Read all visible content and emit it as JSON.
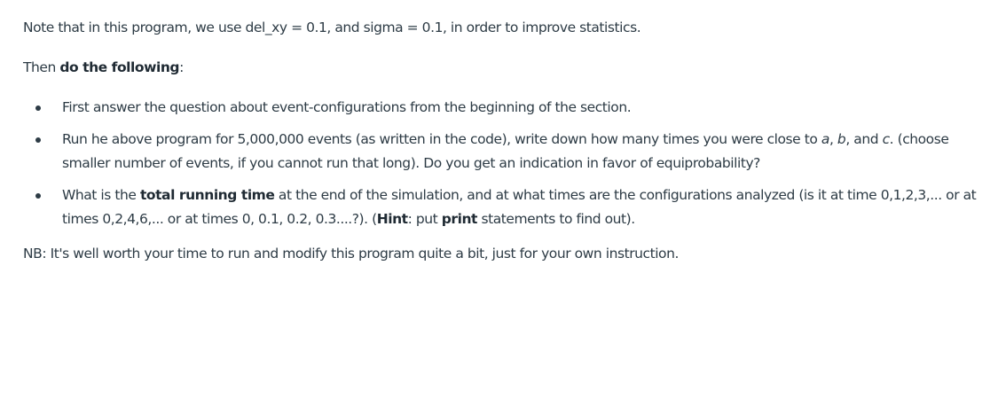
{
  "paragraph_note": "Note that in this program, we use del_xy = 0.1, and sigma = 0.1, in order to improve statistics.",
  "paragraph_then": {
    "prefix": "Then ",
    "bold": "do the following",
    "suffix": ":"
  },
  "bullets": [
    {
      "text": "First answer the  question about event-configurations from the beginning of the section."
    },
    {
      "part1": "Run he above program for 5,000,000 events (as written in the code), write down how many times you were close to ",
      "a": "a",
      "sep1": ", ",
      "b": "b",
      "sep2": ", and ",
      "c": "c",
      "part2": ". (choose smaller number of events, if you cannot run that long). Do you get an indication in favor of equiprobability?"
    },
    {
      "part1": "What is the ",
      "bold1": "total running time",
      "part2": " at the end of the simulation, and at what times are the configurations analyzed  (is it at time 0,1,2,3,... or at times 0,2,4,6,... or at times 0, 0.1, 0.2, 0.3....?). (",
      "bold2": "Hint",
      "part3": ": put ",
      "bold3": "print",
      "part4": " statements to find out)."
    }
  ],
  "paragraph_nb": "NB: It's well worth your time to run and modify this program quite a bit, just for your own instruction."
}
